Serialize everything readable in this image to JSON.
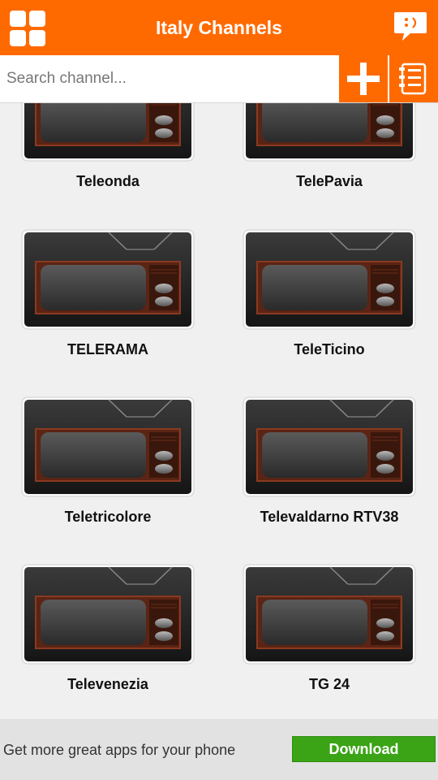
{
  "header": {
    "title": "Italy Channels",
    "menu_icon": "grid-menu-icon",
    "chat_icon": "chat-smiley-icon"
  },
  "search": {
    "placeholder": "Search channel...",
    "value": ""
  },
  "toolbar": {
    "add_icon": "plus-icon",
    "list_icon": "list-icon"
  },
  "channels": [
    {
      "name": "Teleonda"
    },
    {
      "name": "TelePavia"
    },
    {
      "name": "TELERAMA"
    },
    {
      "name": "TeleTicino"
    },
    {
      "name": "Teletricolore"
    },
    {
      "name": "Televaldarno RTV38"
    },
    {
      "name": "Televenezia"
    },
    {
      "name": "TG 24"
    }
  ],
  "banner": {
    "text": "Get more great apps for your phone",
    "button_label": "Download"
  },
  "colors": {
    "accent": "#ff6a00",
    "download": "#3aa416"
  }
}
